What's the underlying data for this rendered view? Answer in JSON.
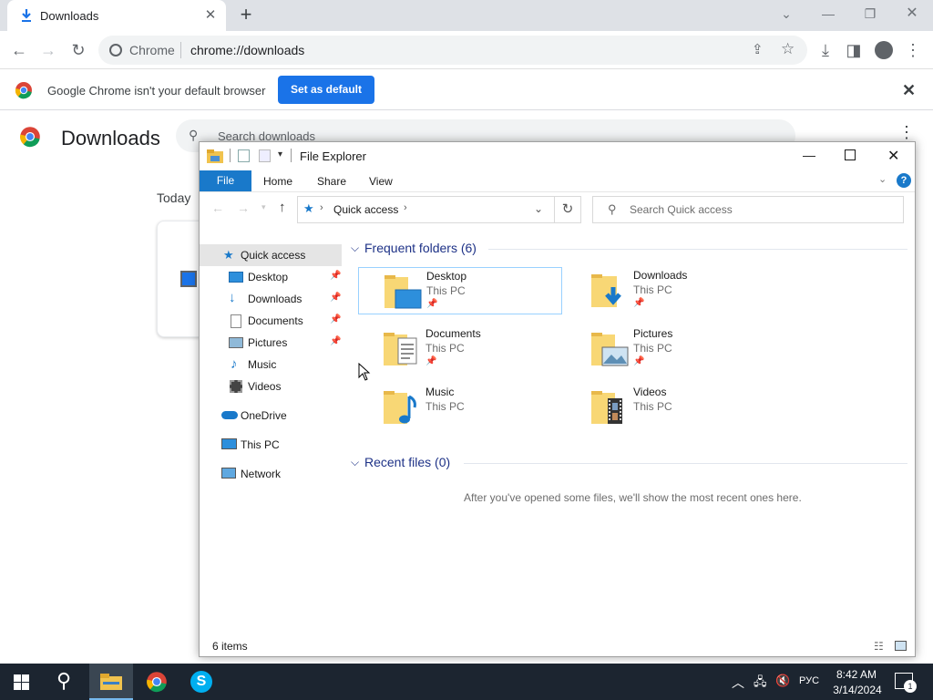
{
  "chrome": {
    "tab_title": "Downloads",
    "omnibox": {
      "site": "Chrome",
      "url": "chrome://downloads"
    },
    "infobar": {
      "message": "Google Chrome isn't your default browser",
      "button": "Set as default"
    },
    "downloads_page": {
      "title": "Downloads",
      "search_placeholder": "Search downloads",
      "date_group": "Today"
    }
  },
  "explorer": {
    "title": "File Explorer",
    "ribbon_tabs": [
      "File",
      "Home",
      "Share",
      "View"
    ],
    "breadcrumb": "Quick access",
    "search_placeholder": "Search Quick access",
    "nav": [
      {
        "label": "Quick access",
        "pinned": false
      },
      {
        "label": "Desktop",
        "pinned": true
      },
      {
        "label": "Downloads",
        "pinned": true
      },
      {
        "label": "Documents",
        "pinned": true
      },
      {
        "label": "Pictures",
        "pinned": true
      },
      {
        "label": "Music",
        "pinned": false
      },
      {
        "label": "Videos",
        "pinned": false
      },
      {
        "label": "OneDrive",
        "pinned": false
      },
      {
        "label": "This PC",
        "pinned": false
      },
      {
        "label": "Network",
        "pinned": false
      }
    ],
    "frequent_header": "Frequent folders (6)",
    "folders": [
      {
        "name": "Desktop",
        "location": "This PC",
        "pinned": true
      },
      {
        "name": "Downloads",
        "location": "This PC",
        "pinned": true
      },
      {
        "name": "Documents",
        "location": "This PC",
        "pinned": true
      },
      {
        "name": "Pictures",
        "location": "This PC",
        "pinned": true
      },
      {
        "name": "Music",
        "location": "This PC",
        "pinned": false
      },
      {
        "name": "Videos",
        "location": "This PC",
        "pinned": false
      }
    ],
    "recent_header": "Recent files (0)",
    "recent_empty": "After you've opened some files, we'll show the most recent ones here.",
    "status": "6 items"
  },
  "taskbar": {
    "time": "8:42 AM",
    "date": "3/14/2024",
    "language": "РУС",
    "notification_count": "1"
  }
}
